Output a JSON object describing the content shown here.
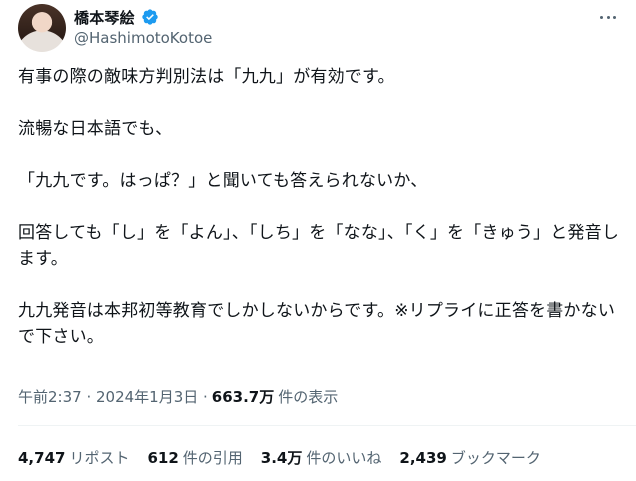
{
  "author": {
    "display_name": "橋本琴絵",
    "handle": "@HashimotoKotoe",
    "verified_color": "#1d9bf0"
  },
  "tweet": {
    "text": "有事の際の敵味方判別法は「九九」が有効です。\n\n流暢な日本語でも、\n\n「九九です。はっぱ？」と聞いても答えられないか、\n\n回答しても「し」を「よん」、「しち」を「なな」、「く」を「きゅう」と発音します。\n\n九九発音は本邦初等教育でしかしないからです。※リプライに正答を書かないで下さい。"
  },
  "meta": {
    "timestamp": "午前2:37 · 2024年1月3日 ·",
    "views_count": "663.7万",
    "views_label": "件の表示"
  },
  "stats": {
    "reposts_num": "4,747",
    "reposts_label": "リポスト",
    "quotes_num": "612",
    "quotes_label": "件の引用",
    "likes_num": "3.4万",
    "likes_label": "件のいいね",
    "bookmarks_num": "2,439",
    "bookmarks_label": "ブックマーク"
  }
}
